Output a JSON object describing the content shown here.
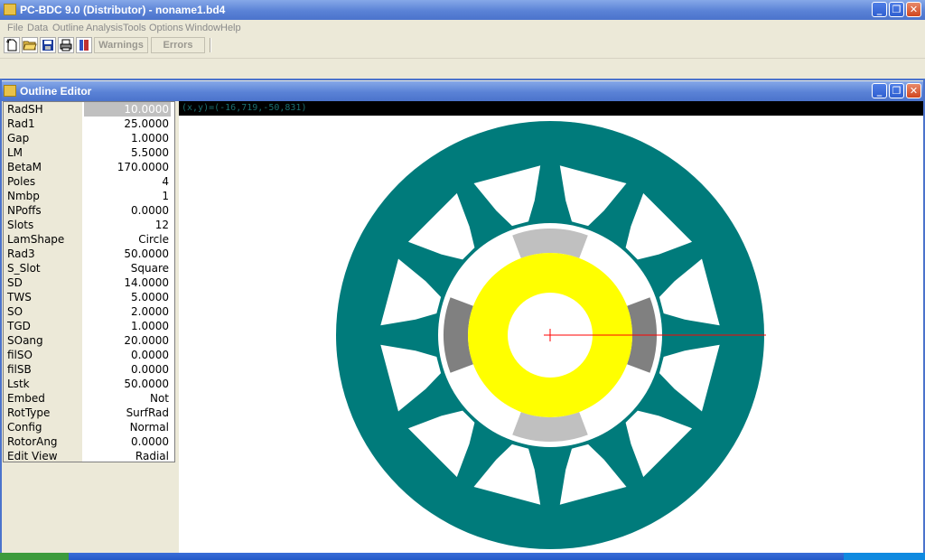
{
  "main_window": {
    "title": "PC-BDC 9.0 (Distributor) - noname1.bd4"
  },
  "menu": [
    "File",
    "Data",
    "Outline",
    "Analysis",
    "Tools",
    "Options",
    "Window",
    "Help"
  ],
  "toolbar": {
    "warnings_label": "Warnings",
    "errors_label": "Errors"
  },
  "child_window": {
    "title": "Outline Editor"
  },
  "properties": [
    {
      "name": "RadSH",
      "value": "10.0000"
    },
    {
      "name": "Rad1",
      "value": "25.0000"
    },
    {
      "name": "Gap",
      "value": "1.0000"
    },
    {
      "name": "LM",
      "value": "5.5000"
    },
    {
      "name": "BetaM",
      "value": "170.0000"
    },
    {
      "name": "Poles",
      "value": "4"
    },
    {
      "name": "Nmbp",
      "value": "1"
    },
    {
      "name": "NPoffs",
      "value": "0.0000"
    },
    {
      "name": "Slots",
      "value": "12"
    },
    {
      "name": "LamShape",
      "value": "Circle"
    },
    {
      "name": "Rad3",
      "value": "50.0000"
    },
    {
      "name": "S_Slot",
      "value": "Square"
    },
    {
      "name": "SD",
      "value": "14.0000"
    },
    {
      "name": "TWS",
      "value": "5.0000"
    },
    {
      "name": "SO",
      "value": "2.0000"
    },
    {
      "name": "TGD",
      "value": "1.0000"
    },
    {
      "name": "SOang",
      "value": "20.0000"
    },
    {
      "name": "filSO",
      "value": "0.0000"
    },
    {
      "name": "filSB",
      "value": "0.0000"
    },
    {
      "name": "Lstk",
      "value": "50.0000"
    },
    {
      "name": "Embed",
      "value": "Not"
    },
    {
      "name": "RotType",
      "value": "SurfRad"
    },
    {
      "name": "Config",
      "value": "Normal"
    },
    {
      "name": "RotorAng",
      "value": "0.0000"
    },
    {
      "name": "Edit View",
      "value": "Radial"
    }
  ],
  "selected_property": "RadSH",
  "coord_readout": "(x,y)=(-16,719,-50,831)",
  "colors": {
    "stator": "#007b7b",
    "magnet_dark": "#808080",
    "magnet_light": "#c0c0c0",
    "rotor": "#ffff00",
    "titlebar": "#4b73cc",
    "crosshair": "#ff0000"
  },
  "icons": {
    "toolbar": [
      "new-file-icon",
      "open-folder-icon",
      "save-icon",
      "print-icon",
      "tool-icon"
    ]
  }
}
